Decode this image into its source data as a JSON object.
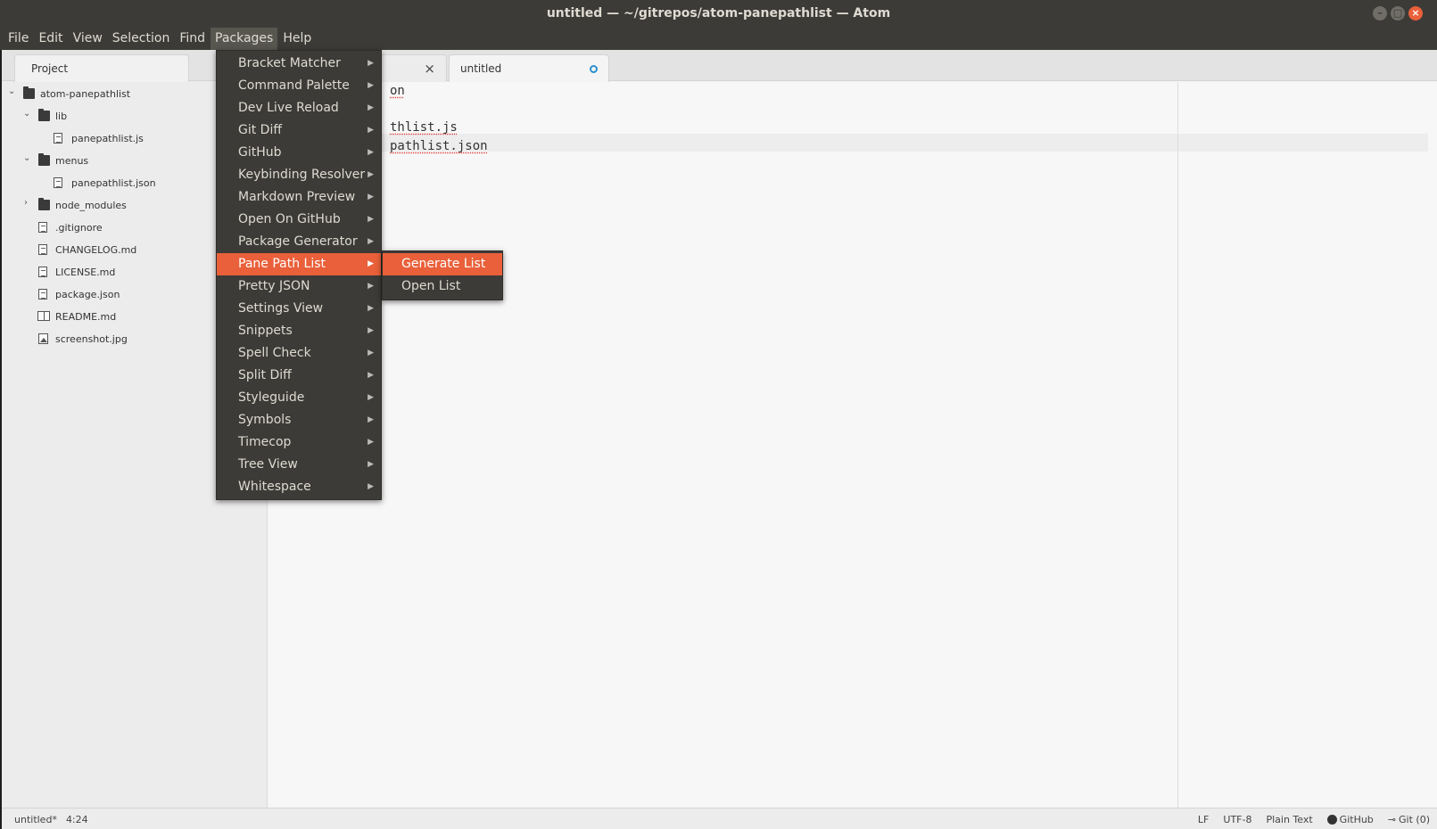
{
  "window": {
    "title": "untitled — ~/gitrepos/atom-panepathlist — Atom",
    "controls": [
      "–",
      "□",
      "×"
    ]
  },
  "menubar": {
    "items": [
      "File",
      "Edit",
      "View",
      "Selection",
      "Find",
      "Packages",
      "Help"
    ],
    "open_item": "Packages"
  },
  "tree": {
    "tab_label": "Project",
    "nodes": [
      {
        "label": "atom-panepathlist",
        "type": "folder",
        "expanded": true,
        "depth": 0
      },
      {
        "label": "lib",
        "type": "folder",
        "expanded": true,
        "depth": 1
      },
      {
        "label": "panepathlist.js",
        "type": "file",
        "depth": 2
      },
      {
        "label": "menus",
        "type": "folder",
        "expanded": true,
        "depth": 1
      },
      {
        "label": "panepathlist.json",
        "type": "file",
        "depth": 2
      },
      {
        "label": "node_modules",
        "type": "folder",
        "expanded": false,
        "depth": 1
      },
      {
        "label": ".gitignore",
        "type": "file",
        "depth": 1
      },
      {
        "label": "CHANGELOG.md",
        "type": "file",
        "depth": 1
      },
      {
        "label": "LICENSE.md",
        "type": "file",
        "depth": 1
      },
      {
        "label": "package.json",
        "type": "file",
        "depth": 1
      },
      {
        "label": "README.md",
        "type": "book",
        "depth": 1
      },
      {
        "label": "screenshot.jpg",
        "type": "image",
        "depth": 1
      }
    ]
  },
  "editor": {
    "tabs": [
      {
        "label": "",
        "close": "×"
      },
      {
        "label": "untitled",
        "modified": true
      }
    ],
    "lines": [
      "on",
      "",
      "thlist.js",
      "pathlist.json"
    ]
  },
  "packages_menu": {
    "items": [
      "Bracket Matcher",
      "Command Palette",
      "Dev Live Reload",
      "Git Diff",
      "GitHub",
      "Keybinding Resolver",
      "Markdown Preview",
      "Open On GitHub",
      "Package Generator",
      "Pane Path List",
      "Pretty JSON",
      "Settings View",
      "Snippets",
      "Spell Check",
      "Split Diff",
      "Styleguide",
      "Symbols",
      "Timecop",
      "Tree View",
      "Whitespace"
    ],
    "highlighted": "Pane Path List",
    "submenu": {
      "items": [
        "Generate List",
        "Open List"
      ],
      "highlighted": "Generate List"
    }
  },
  "statusbar": {
    "file": "untitled*",
    "cursor": "4:24",
    "line_ending": "LF",
    "encoding": "UTF-8",
    "grammar": "Plain Text",
    "github": "GitHub",
    "git": "Git (0)"
  },
  "colors": {
    "accent": "#e9603a",
    "menu_bg": "#3c3b37",
    "modified_dot": "#2a8fd0"
  }
}
